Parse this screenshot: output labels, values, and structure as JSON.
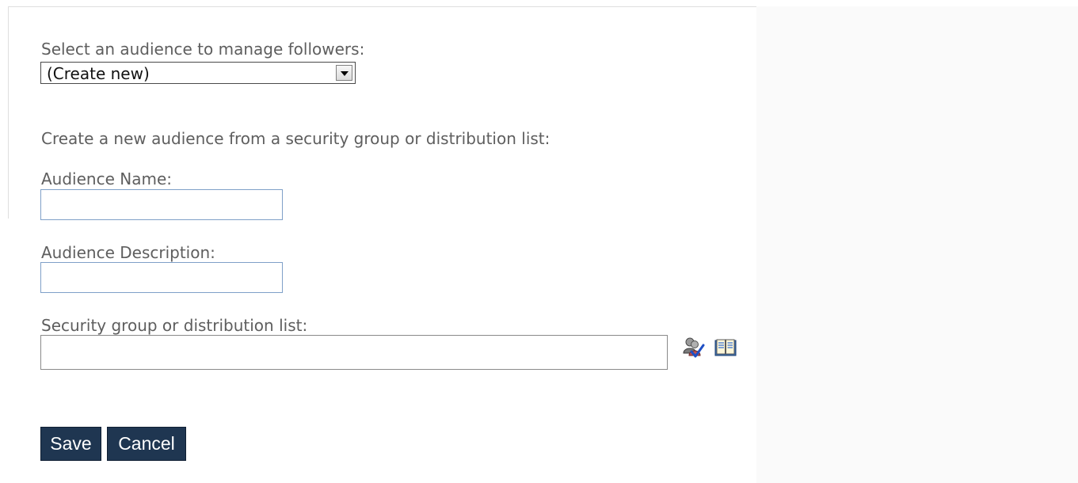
{
  "audience_select": {
    "label": "Select an audience to manage followers:",
    "selected": "(Create new)"
  },
  "create_section": {
    "heading": "Create a new audience from a security group or distribution list:",
    "name_label": "Audience Name:",
    "name_value": "",
    "description_label": "Audience Description:",
    "description_value": "",
    "group_label": "Security group or distribution list:",
    "group_value": ""
  },
  "icons": {
    "check_names": "check-names-icon",
    "address_book": "address-book-icon"
  },
  "buttons": {
    "save_label": "Save",
    "cancel_label": "Cancel"
  },
  "colors": {
    "button_bg": "#1f3651",
    "input_border": "#7fa0c8",
    "label_text": "#5e5e5e",
    "right_panel_bg": "#fafafa"
  }
}
